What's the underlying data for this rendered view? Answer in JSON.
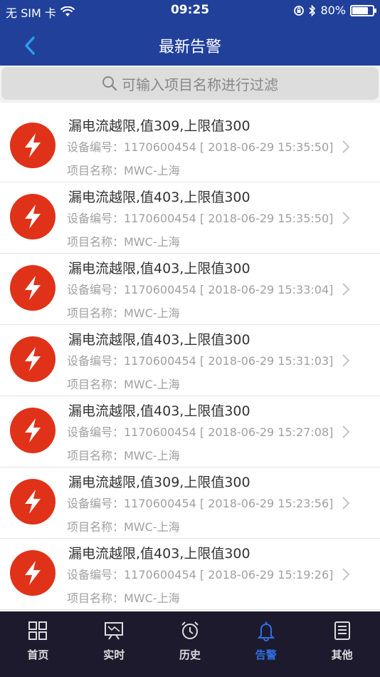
{
  "status_bar": {
    "carrier": "无 SIM 卡",
    "time": "09:25",
    "battery": "80%",
    "battery_level": 0.8
  },
  "nav": {
    "title": "最新告警"
  },
  "search": {
    "placeholder": "可输入项目名称进行过滤"
  },
  "alerts": [
    {
      "title": "漏电流越限,值309,上限值300",
      "device": "设备编号：1170600454 [ 2018-06-29 15:35:50]",
      "project": "项目名称：MWC-上海"
    },
    {
      "title": "漏电流越限,值403,上限值300",
      "device": "设备编号：1170600454 [ 2018-06-29 15:35:50]",
      "project": "项目名称：MWC-上海"
    },
    {
      "title": "漏电流越限,值403,上限值300",
      "device": "设备编号：1170600454 [ 2018-06-29 15:33:04]",
      "project": "项目名称：MWC-上海"
    },
    {
      "title": "漏电流越限,值403,上限值300",
      "device": "设备编号：1170600454 [ 2018-06-29 15:31:03]",
      "project": "项目名称：MWC-上海"
    },
    {
      "title": "漏电流越限,值403,上限值300",
      "device": "设备编号：1170600454 [ 2018-06-29 15:27:08]",
      "project": "项目名称：MWC-上海"
    },
    {
      "title": "漏电流越限,值309,上限值300",
      "device": "设备编号：1170600454 [ 2018-06-29 15:23:56]",
      "project": "项目名称：MWC-上海"
    },
    {
      "title": "漏电流越限,值403,上限值300",
      "device": "设备编号：1170600454 [ 2018-06-29 15:19:26]",
      "project": "项目名称：MWC-上海"
    }
  ],
  "tabs": [
    {
      "label": "首页",
      "icon": "grid-icon"
    },
    {
      "label": "实时",
      "icon": "monitor-icon"
    },
    {
      "label": "历史",
      "icon": "alarm-clock-icon"
    },
    {
      "label": "告警",
      "icon": "bell-icon",
      "active": true
    },
    {
      "label": "其他",
      "icon": "list-icon"
    }
  ],
  "colors": {
    "header": "#21409a",
    "alert_icon": "#e03219",
    "tab_active": "#2f6fe6",
    "tabbar": "#1e1a2e"
  }
}
